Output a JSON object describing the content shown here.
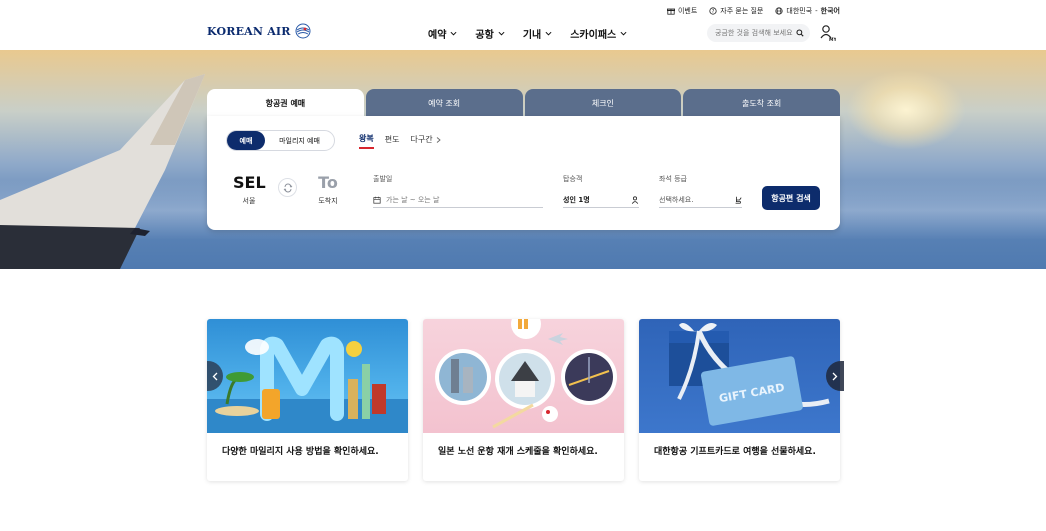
{
  "utility_bar": {
    "events": "이벤트",
    "faq": "자주 묻는 질문",
    "country": "대한민국",
    "separator": "-",
    "language": "한국어"
  },
  "header": {
    "logo_text": "KOREAN AIR",
    "nav": [
      {
        "label": "예약"
      },
      {
        "label": "공항"
      },
      {
        "label": "기내"
      },
      {
        "label": "스카이패스"
      }
    ],
    "search_placeholder": "궁금한 것을 검색해 보세요",
    "my_label": "MY"
  },
  "booking": {
    "tabs": [
      "항공권 예매",
      "예약 조회",
      "체크인",
      "출도착 조회"
    ],
    "active_tab": 0,
    "mode_toggle": {
      "selected": "예매",
      "other": "마일리지 예매"
    },
    "trip_types": [
      "왕복",
      "편도",
      "다구간"
    ],
    "selected_trip": "왕복",
    "departure": {
      "code": "SEL",
      "city": "서울"
    },
    "arrival": {
      "code": "To",
      "city": "도착지"
    },
    "date": {
      "label": "출발일",
      "placeholder": "가는 날 ~ 오는 날"
    },
    "passengers": {
      "label": "탑승객",
      "value": "성인 1명"
    },
    "seat_class": {
      "label": "좌석 등급",
      "placeholder": "선택하세요."
    },
    "search_button": "항공편 검색"
  },
  "promos": [
    {
      "caption": "다양한 마일리지 사용 방법을 확인하세요.",
      "icon": "mileage-illustration"
    },
    {
      "caption": "일본 노선 운항 재개 스케줄을 확인하세요.",
      "icon": "japan-cities-illustration"
    },
    {
      "caption": "대한항공 기프트카드로 여행을 선물하세요.",
      "icon": "gift-card-illustration",
      "card_text": "GIFT CARD"
    }
  ],
  "colors": {
    "brand_navy": "#0d2c6c",
    "tab_inactive": "#5b6e8c",
    "accent_red": "#d7262e"
  }
}
